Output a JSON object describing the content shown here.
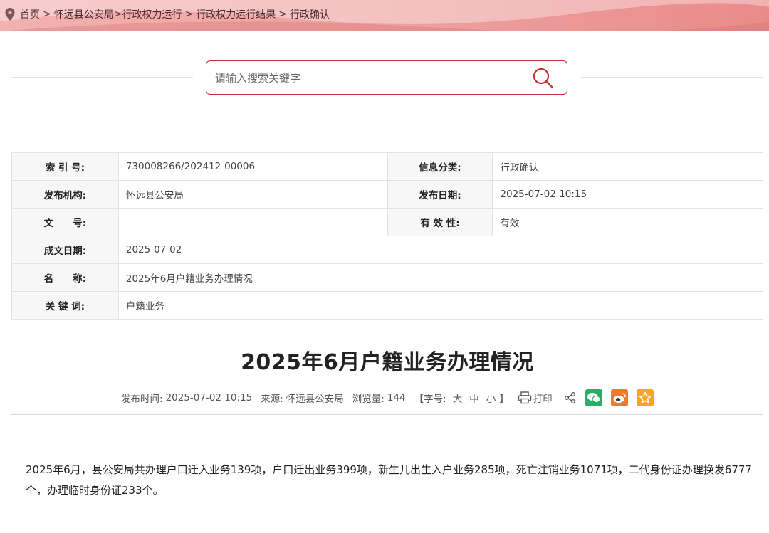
{
  "breadcrumb": {
    "items": [
      "首页",
      "怀远县公安局",
      "行政权力运行",
      "行政权力运行结果",
      "行政确认"
    ],
    "seps": [
      ">",
      ">",
      ">",
      ">"
    ]
  },
  "search": {
    "placeholder": "请输入搜索关键字"
  },
  "info": {
    "index_label": "索 引 号:",
    "index_value": "730008266/202412-00006",
    "category_label": "信息分类:",
    "category_value": "行政确认",
    "publisher_label": "发布机构:",
    "publisher_value": "怀远县公安局",
    "pubdate_label": "发布日期:",
    "pubdate_value": "2025-07-02 10:15",
    "docno_label": "文　　号:",
    "docno_value": "",
    "validity_label": "有 效 性:",
    "validity_value": "有效",
    "written_label": "成文日期:",
    "written_value": "2025-07-02",
    "name_label": "名　　称:",
    "name_value": "2025年6月户籍业务办理情况",
    "keyword_label": "关 键 词:",
    "keyword_value": "户籍业务"
  },
  "article": {
    "title": "2025年6月户籍业务办理情况",
    "meta": {
      "time_label": "发布时间:",
      "time_value": "2025-07-02 10:15",
      "source_label": "来源:",
      "source_value": "怀远县公安局",
      "views_label": "浏览量:",
      "views_value": "144",
      "fontsize_label": "【字号:",
      "fs_large": "大",
      "fs_medium": "中",
      "fs_small": "小",
      "fontsize_close": "】",
      "print_label": "打印"
    },
    "body": "2025年6月，县公安局共办理户口迁入业务139项，户口迁出业务399项，新生儿出生入户业务285项，死亡注销业务1071项，二代身份证办理换发6777个，办理临时身份证233个。"
  },
  "colors": {
    "accent": "#c9302c",
    "wechat": "#2aae67",
    "weibo": "#f07a2e",
    "favorite": "#f5a623"
  },
  "icons": [
    "location-pin-icon",
    "search-icon",
    "print-icon",
    "share-icon",
    "wechat-icon",
    "weibo-icon",
    "star-icon"
  ]
}
